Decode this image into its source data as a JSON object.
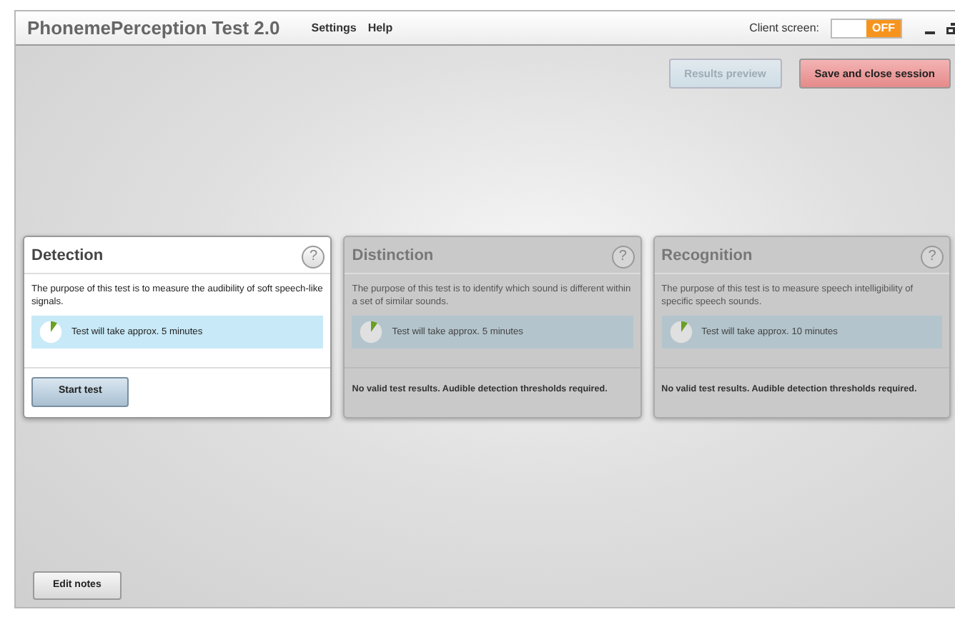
{
  "window": {
    "title": "PhonemePerception Test 2.0"
  },
  "menu": [
    "Settings",
    "Help"
  ],
  "client_screen": {
    "label": "Client screen:",
    "on": false,
    "state_text": "OFF"
  },
  "actions": [
    {
      "label": "Results preview",
      "kind": "secondary",
      "disabled": true
    },
    {
      "label": "Save and close session",
      "kind": "danger",
      "disabled": false
    }
  ],
  "tests": [
    {
      "title": "Detection",
      "help": "?",
      "disabled": false,
      "description": "The purpose of this test is to measure the audibility of soft speech-like signals.",
      "duration": "Test will take approx. 5 minutes",
      "footer": {
        "kind": "button",
        "text": "Start test"
      }
    },
    {
      "title": "Distinction",
      "help": "?",
      "disabled": true,
      "description": "The purpose of this test is to identify which sound is different within a set of similar sounds.",
      "duration": "Test will take approx. 5 minutes",
      "footer": {
        "kind": "message",
        "text": "No valid test results. Audible detection thresholds required."
      }
    },
    {
      "title": "Recognition",
      "help": "?",
      "disabled": true,
      "description": "The purpose of this test is to measure speech intelligibility of specific speech sounds.",
      "duration": "Test will take approx. 10 minutes",
      "footer": {
        "kind": "message",
        "text": "No valid test results. Audible detection thresholds required."
      }
    }
  ],
  "edit_notes": {
    "label": "Edit notes"
  }
}
